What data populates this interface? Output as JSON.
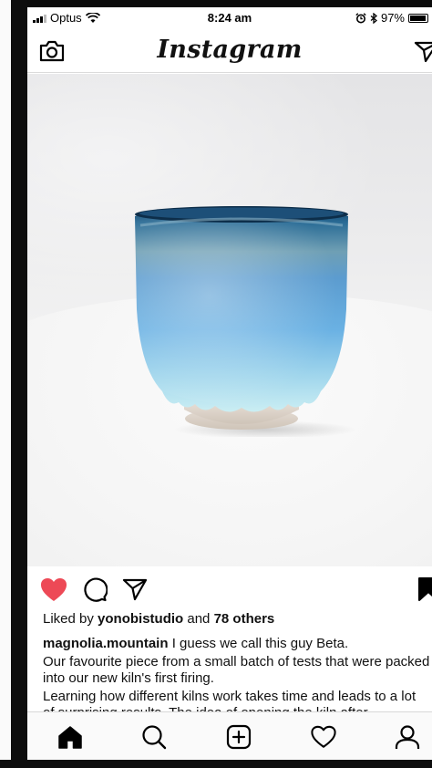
{
  "status_bar": {
    "carrier": "Optus",
    "time": "8:24 am",
    "battery_percent": "97%",
    "battery_level": 0.97
  },
  "header": {
    "logo_text": "Instagram",
    "left_icon": "camera-icon",
    "right_icon": "direct-message-icon"
  },
  "post": {
    "image_description_icon": "ceramic-cup-photo",
    "liked": true,
    "like_color": "#ed4956",
    "likes": {
      "prefix": "Liked by",
      "user": "yonobistudio",
      "conjunction": "and",
      "others": "78 others"
    },
    "caption": {
      "username": "magnolia.mountain",
      "first_line": "I guess we call this guy Beta.",
      "paragraph_2": "Our favourite piece from a small batch of tests that were packed into our new kiln's first firing.",
      "paragraph_3": "Learning how different kilns work takes time and leads to a lot of surprising results. The idea of opening the kiln after"
    }
  },
  "tab_bar": {
    "tabs": [
      "home-icon",
      "search-icon",
      "add-post-icon",
      "activity-heart-icon",
      "profile-icon"
    ]
  }
}
